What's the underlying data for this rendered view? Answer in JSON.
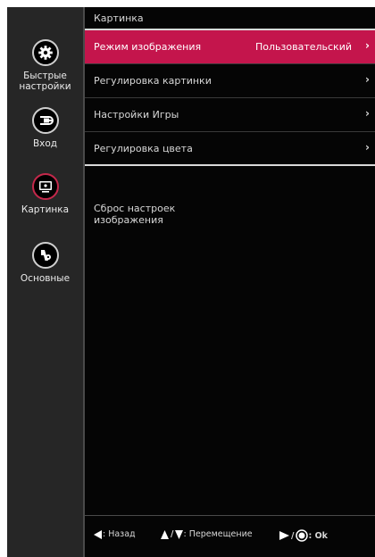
{
  "sidebar": {
    "items": [
      {
        "label_line1": "Быстрые",
        "label_line2": "настройки",
        "icon": "gear-icon"
      },
      {
        "label_line1": "Вход",
        "icon": "input-plug-icon"
      },
      {
        "label_line1": "Картинка",
        "icon": "picture-monitor-icon",
        "active": true
      },
      {
        "label_line1": "Основные",
        "icon": "general-settings-icon"
      }
    ]
  },
  "main": {
    "title": "Картинка",
    "menu": [
      {
        "label": "Режим изображения",
        "value": "Пользовательский",
        "chevron": "›",
        "selected": true
      },
      {
        "label": "Регулировка картинки",
        "chevron": "›"
      },
      {
        "label": "Настройки Игры",
        "chevron": "›"
      },
      {
        "label": "Регулировка цвета",
        "chevron": "›"
      }
    ],
    "reset_line1": "Сброс настроек",
    "reset_line2": "изображения"
  },
  "footer": {
    "back": ": Назад",
    "move_sep": "/",
    "move": ": Перемещение",
    "ok_sep": "/",
    "ok": ": Ok"
  },
  "colors": {
    "accent": "#c4154c",
    "sidebar_bg": "#262626",
    "panel_bg": "#050505"
  }
}
